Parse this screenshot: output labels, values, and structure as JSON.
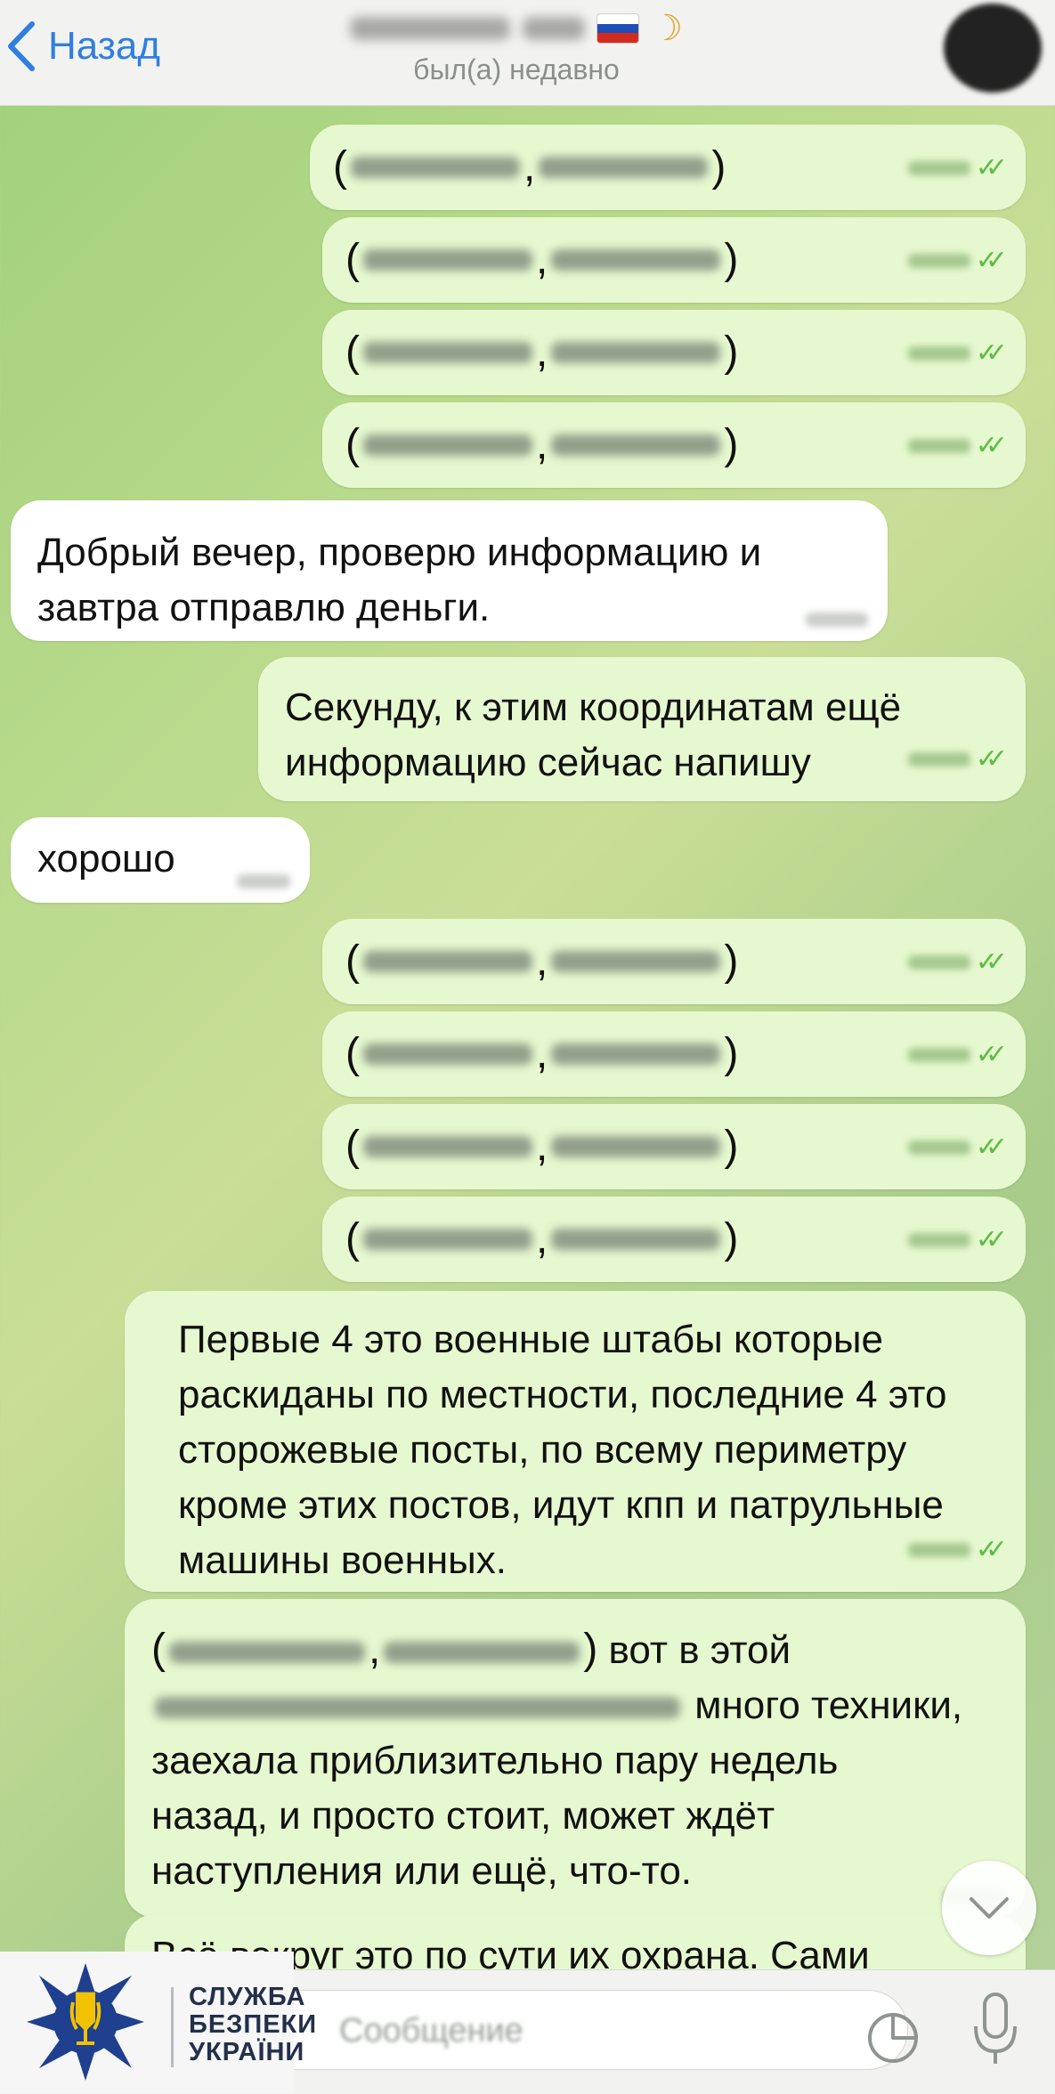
{
  "header": {
    "back_label": "Назад",
    "contact_status": "был(а) недавно",
    "flag_colors": [
      "#ffffff",
      "#1f4fb8",
      "#d52b1e"
    ],
    "emoji": "moon-face-emoji"
  },
  "messages": {
    "coords_group1": [
      {
        "direction": "out",
        "kind": "redacted-coordinates"
      },
      {
        "direction": "out",
        "kind": "redacted-coordinates"
      },
      {
        "direction": "out",
        "kind": "redacted-coordinates"
      },
      {
        "direction": "out",
        "kind": "redacted-coordinates"
      }
    ],
    "in_1": "Добрый вечер, проверю информацию и завтра отправлю деньги.",
    "out_1": "Секунду, к этим координатам ещё информацию сейчас напишу",
    "in_2": "хорошо",
    "coords_group2": [
      {
        "direction": "out",
        "kind": "redacted-coordinates"
      },
      {
        "direction": "out",
        "kind": "redacted-coordinates"
      },
      {
        "direction": "out",
        "kind": "redacted-coordinates"
      },
      {
        "direction": "out",
        "kind": "redacted-coordinates"
      }
    ],
    "out_2": "Первые 4 это военные штабы которые раскиданы по местности, последние 4 это сторожевые посты, по всему периметру кроме этих постов, идут кпп и патрульные машины военных.",
    "out_3_part1": "вот в этой",
    "out_3_part2": "много техники,",
    "out_3_part3": "заехала приблизительно пару недель назад, и просто стоит, может ждёт наступления или ещё, что-то.",
    "out_4": "Всё вокруг это по сути их охрана. Сами"
  },
  "input": {
    "placeholder": "Сообщение"
  },
  "watermark": {
    "line1": "СЛУЖБА",
    "line2": "БЕЗПЕКИ",
    "line3": "УКРАЇНИ"
  },
  "colors": {
    "accent": "#2f7fe0",
    "outgoing_bubble": "#e6f8cf",
    "incoming_bubble": "#ffffff",
    "read_check": "#5ebc45",
    "sbu_blue": "#1f3f8f",
    "sbu_gold": "#f2c200"
  }
}
